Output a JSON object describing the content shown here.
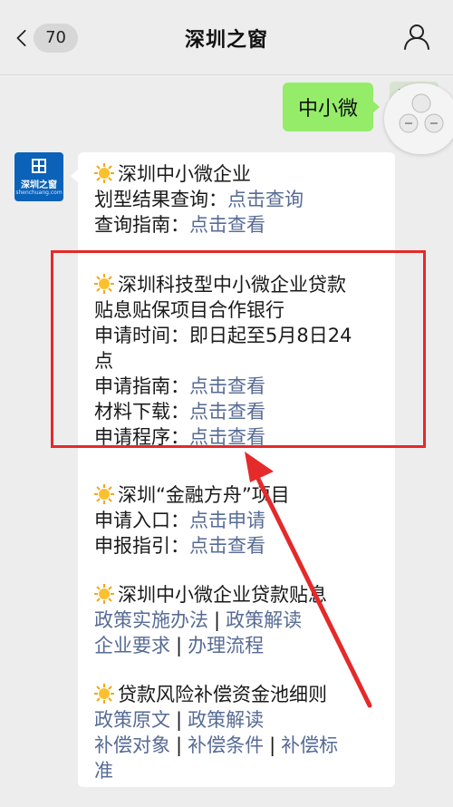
{
  "header": {
    "back_count": "70",
    "title": "深圳之窗"
  },
  "sender": {
    "avatar_text": "深圳之窗",
    "avatar_subtext": "shenchuang.com"
  },
  "outgoing": {
    "text": "中小微"
  },
  "incoming": {
    "s1": {
      "title": "深圳中小微企业",
      "l2_prefix": "划型结果查询：",
      "l2_link": "点击查询",
      "l3_prefix": "查询指南：",
      "l3_link": "点击查看"
    },
    "s2": {
      "title": "深圳科技型中小微企业贷款",
      "title2": "贴息贴保项目合作银行",
      "time": "申请时间：即日起至5月8日24",
      "time2": "点",
      "r1_prefix": "申请指南：",
      "r1_link": "点击查看",
      "r2_prefix": "材料下载：",
      "r2_link": "点击查看",
      "r3_prefix": "申请程序：",
      "r3_link": "点击查看"
    },
    "s3": {
      "title": "深圳“金融方舟”项目",
      "r1_prefix": "申请入口：",
      "r1_link": "点击申请",
      "r2_prefix": "申报指引：",
      "r2_link": "点击查看"
    },
    "s4": {
      "title": "深圳中小微企业贷款贴息",
      "l1a": "政策实施办法",
      "l1b": "政策解读",
      "l2a": "企业要求",
      "l2b": "办理流程",
      "sep": "|"
    },
    "s5": {
      "title": "贷款风险补偿资金池细则",
      "l1a": "政策原文",
      "l1b": "政策解读",
      "l2a": "补偿对象",
      "l2b": "补偿条件",
      "l2c": "补偿标",
      "l3": "准",
      "sep": "|"
    }
  },
  "colors": {
    "link": "#576b95",
    "out_bubble": "#95ec69",
    "annotation": "#e42a2a"
  },
  "icons": [
    "back-chevron-icon",
    "profile-icon",
    "sun-emoji-icon"
  ]
}
